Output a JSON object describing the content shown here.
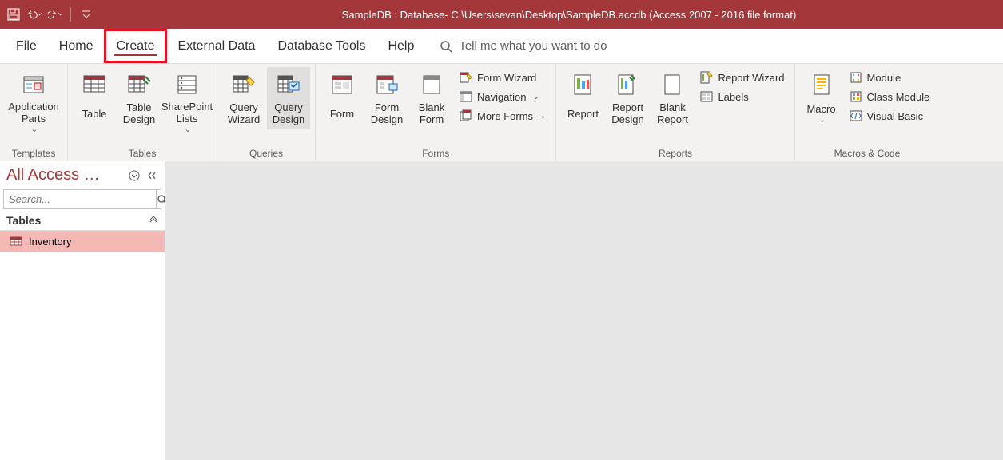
{
  "titlebar": {
    "title": "SampleDB : Database- C:\\Users\\sevan\\Desktop\\SampleDB.accdb (Access 2007 - 2016 file format)"
  },
  "tabs": {
    "file": "File",
    "home": "Home",
    "create": "Create",
    "external": "External Data",
    "dbtools": "Database Tools",
    "help": "Help",
    "tellme_placeholder": "Tell me what you want to do"
  },
  "ribbon": {
    "templates": {
      "label": "Templates",
      "app_parts": "Application Parts"
    },
    "tables": {
      "label": "Tables",
      "table": "Table",
      "table_design": "Table Design",
      "sharepoint": "SharePoint Lists"
    },
    "queries": {
      "label": "Queries",
      "wizard": "Query Wizard",
      "design": "Query Design"
    },
    "forms": {
      "label": "Forms",
      "form": "Form",
      "form_design": "Form Design",
      "blank": "Blank Form",
      "form_wizard": "Form Wizard",
      "navigation": "Navigation",
      "more": "More Forms"
    },
    "reports": {
      "label": "Reports",
      "report": "Report",
      "report_design": "Report Design",
      "blank": "Blank Report",
      "wizard": "Report Wizard",
      "labels": "Labels"
    },
    "macros": {
      "label": "Macros & Code",
      "macro": "Macro",
      "module": "Module",
      "class_module": "Class Module",
      "vb": "Visual Basic"
    }
  },
  "nav": {
    "title": "All Access …",
    "search_placeholder": "Search...",
    "category": "Tables",
    "items": [
      "Inventory"
    ]
  }
}
